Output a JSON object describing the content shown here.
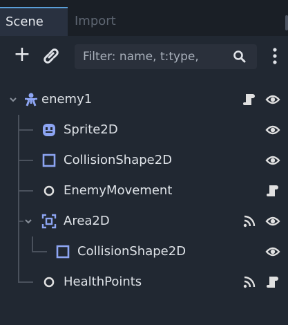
{
  "tabs": {
    "scene": "Scene",
    "import": "Import"
  },
  "toolbar": {
    "filter_placeholder": "Filter: name, t:type,",
    "add_label": "+"
  },
  "colors": {
    "accent": "#5a9fd8",
    "node2d": "#8da5f3",
    "script": "#e0e0e0",
    "visible": "#e0e0e0"
  },
  "tree": [
    {
      "name": "enemy1",
      "icon": "scene-root-icon",
      "expanded": true,
      "depth": 0,
      "indicators": [
        "script-icon",
        "visibility-icon"
      ]
    },
    {
      "name": "Sprite2D",
      "icon": "sprite2d-icon",
      "depth": 1,
      "indicators": [
        "visibility-icon"
      ]
    },
    {
      "name": "CollisionShape2D",
      "icon": "collisionshape2d-icon",
      "depth": 1,
      "indicators": [
        "visibility-icon"
      ]
    },
    {
      "name": "EnemyMovement",
      "icon": "node-icon",
      "depth": 1,
      "indicators": [
        "script-icon"
      ]
    },
    {
      "name": "Area2D",
      "icon": "area2d-icon",
      "expanded": true,
      "depth": 1,
      "indicators": [
        "signal-icon",
        "visibility-icon"
      ]
    },
    {
      "name": "CollisionShape2D",
      "icon": "collisionshape2d-icon",
      "depth": 2,
      "indicators": [
        "visibility-icon"
      ]
    },
    {
      "name": "HealthPoints",
      "icon": "node-icon",
      "depth": 1,
      "indicators": [
        "signal-icon",
        "script-icon"
      ]
    }
  ]
}
